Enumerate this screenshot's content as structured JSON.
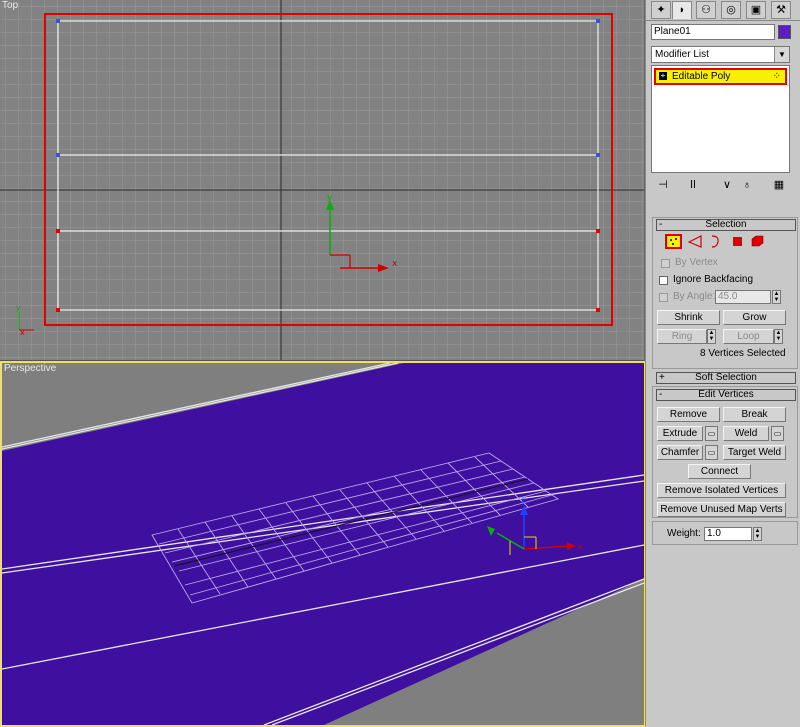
{
  "viewports": {
    "top": {
      "label": "Top"
    },
    "perspective": {
      "label": "Perspective"
    },
    "axis_x": "x",
    "axis_y": "y",
    "axis_z": "z"
  },
  "panel": {
    "tabs": [
      "create-icon",
      "modify-icon",
      "hierarchy-icon",
      "motion-icon",
      "display-icon",
      "utilities-icon"
    ],
    "object_name": "Plane01",
    "object_color": "#5a1ec8",
    "modifier_list": "Modifier List",
    "stack_item": "Editable Poly",
    "selection": {
      "title": "Selection",
      "by_vertex": "By Vertex",
      "ignore_backfacing": "Ignore Backfacing",
      "by_angle": "By Angle:",
      "angle_value": "45.0",
      "shrink": "Shrink",
      "grow": "Grow",
      "ring": "Ring",
      "loop": "Loop",
      "status": "8 Vertices Selected"
    },
    "soft_selection": {
      "title": "Soft Selection"
    },
    "edit_vertices": {
      "title": "Edit Vertices",
      "remove": "Remove",
      "break": "Break",
      "extrude": "Extrude",
      "weld": "Weld",
      "chamfer": "Chamfer",
      "target_weld": "Target Weld",
      "connect": "Connect",
      "remove_isolated": "Remove Isolated Vertices",
      "remove_unused": "Remove Unused Map Verts",
      "weight_label": "Weight:",
      "weight_value": "1.0"
    },
    "signs": {
      "minus": "-",
      "plus": "+"
    }
  },
  "colors": {
    "purple": "#3f0fa0",
    "selection_red": "#e00000",
    "highlight_yellow": "#f7f000"
  }
}
